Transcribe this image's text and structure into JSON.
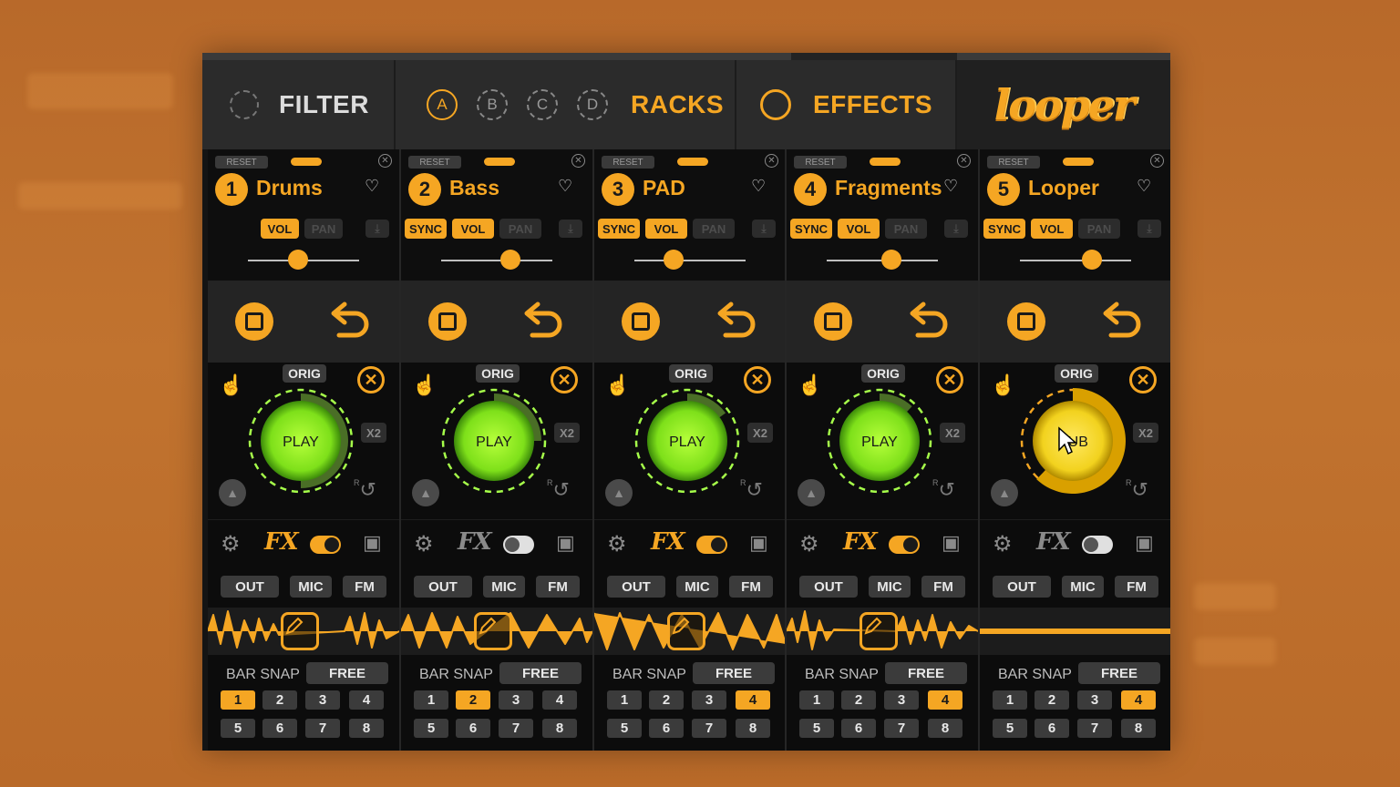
{
  "tabs": {
    "filter": "FILTER",
    "racks_label": "RACKS",
    "rack_buttons": [
      "A",
      "B",
      "C",
      "D"
    ],
    "effects": "EFFECTS",
    "logo": "looper"
  },
  "colors": {
    "accent": "#f5a623",
    "play_green": "#7ee01a",
    "play_yellow": "#f2d21e",
    "panel": "#0c0c0c"
  },
  "strips": [
    {
      "num": "1",
      "name": "Drums",
      "sync": "",
      "vol": "VOL",
      "pan": "PAN",
      "slider": 0.45,
      "play": "PLAY",
      "fx_on": true,
      "bar": "1",
      "wave": "drums",
      "state": "play",
      "progress": 0.5
    },
    {
      "num": "2",
      "name": "Bass",
      "sync": "SYNC",
      "vol": "VOL",
      "pan": "PAN",
      "slider": 0.62,
      "play": "PLAY",
      "fx_on": false,
      "bar": "2",
      "wave": "bass",
      "state": "play",
      "progress": 0.25
    },
    {
      "num": "3",
      "name": "PAD",
      "sync": "SYNC",
      "vol": "VOL",
      "pan": "PAN",
      "slider": 0.35,
      "play": "PLAY",
      "fx_on": true,
      "bar": "4",
      "wave": "pad",
      "state": "play",
      "progress": 0.15
    },
    {
      "num": "4",
      "name": "Fragments",
      "sync": "SYNC",
      "vol": "VOL",
      "pan": "PAN",
      "slider": 0.58,
      "play": "PLAY",
      "fx_on": true,
      "bar": "4",
      "wave": "frag",
      "state": "play",
      "progress": 0.12
    },
    {
      "num": "5",
      "name": "Looper",
      "sync": "SYNC",
      "vol": "VOL",
      "pan": "PAN",
      "slider": 0.65,
      "play": "DUB",
      "fx_on": false,
      "bar": "4",
      "wave": "flat",
      "state": "dub",
      "progress": 0.62
    }
  ],
  "labels": {
    "reset": "RESET",
    "orig": "ORIG",
    "x2": "X2",
    "fx": "FX",
    "out": "OUT",
    "mic": "MIC",
    "fm": "FM",
    "bar_snap": "BAR SNAP",
    "free": "FREE",
    "bar_numbers": [
      "1",
      "2",
      "3",
      "4",
      "5",
      "6",
      "7",
      "8"
    ]
  }
}
